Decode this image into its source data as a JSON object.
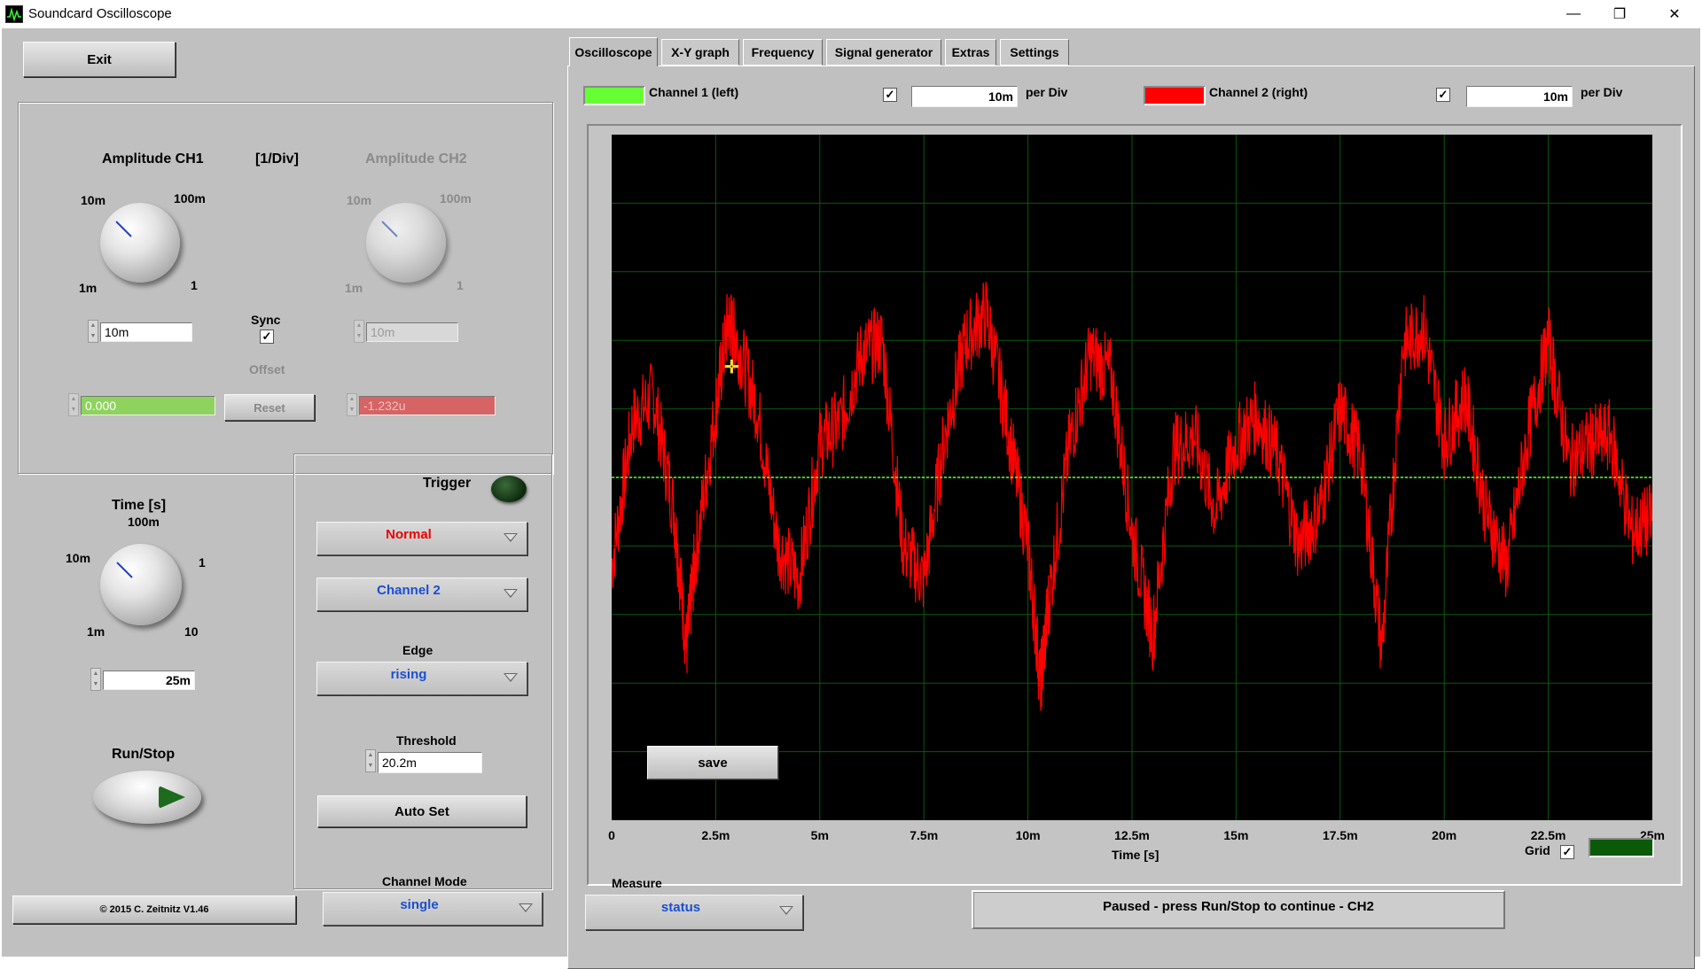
{
  "window": {
    "title": "Soundcard Oscilloscope",
    "minimize": "—",
    "restore": "❐",
    "close": "✕"
  },
  "left": {
    "exit_label": "Exit",
    "amp_ch1_title": "Amplitude CH1",
    "unit_label": "[1/Div]",
    "amp_ch2_title": "Amplitude CH2",
    "amp_ch1_scale": {
      "min": "1m",
      "a": "10m",
      "b": "100m",
      "max": "1"
    },
    "amp_ch2_scale": {
      "min": "1m",
      "a": "10m",
      "b": "100m",
      "max": "1"
    },
    "amp_ch1_value": "10m",
    "amp_ch2_value": "10m",
    "sync_label": "Sync",
    "sync_checked": "✓",
    "offset_label": "Offset",
    "offset_ch1_value": "0.000",
    "offset_ch2_value": "-1.232u",
    "reset_label": "Reset",
    "time_title": "Time [s]",
    "time_scale": {
      "min": "1m",
      "a": "10m",
      "b": "100m",
      "c": "1",
      "max": "10"
    },
    "time_value": "25m",
    "runstop_label": "Run/Stop",
    "copyright": "© 2015  C. Zeitnitz V1.46",
    "channel_mode_label": "Channel Mode",
    "channel_mode_value": "single"
  },
  "trigger": {
    "title": "Trigger",
    "mode": "Normal",
    "channel": "Channel 2",
    "edge_label": "Edge",
    "edge": "rising",
    "threshold_label": "Threshold",
    "threshold_value": "20.2m",
    "autoset_label": "Auto Set"
  },
  "tabs": [
    "Oscilloscope",
    "X-Y graph",
    "Frequency",
    "Signal generator",
    "Extras",
    "Settings"
  ],
  "scope": {
    "ch1_label": "Channel 1 (left)",
    "ch2_label": "Channel 2 (right)",
    "ch1_color": "#66ff33",
    "ch2_color": "#ff0000",
    "ch1_check": "✓",
    "ch2_check": "✓",
    "ch1_perdiv": "10m",
    "ch2_perdiv": "10m",
    "perdiv_label": "per Div",
    "save_label": "save",
    "x_ticks": [
      "0",
      "2.5m",
      "5m",
      "7.5m",
      "10m",
      "12.5m",
      "15m",
      "17.5m",
      "20m",
      "22.5m",
      "25m"
    ],
    "x_axis_label": "Time [s]",
    "grid_label": "Grid",
    "grid_check": "✓",
    "grid_color": "#0a5a0a",
    "measure_label": "Measure",
    "measure_value": "status",
    "status_text": "Paused - press Run/Stop to continue - CH2"
  },
  "chart_data": {
    "type": "line",
    "xlabel": "Time [s]",
    "xlim": [
      0,
      0.025
    ],
    "ylim_div": [
      -5,
      5
    ],
    "series": [
      {
        "name": "Channel 1 (left)",
        "color": "#66ff33",
        "x": [
          0,
          0.025
        ],
        "y_div": [
          0,
          0
        ]
      },
      {
        "name": "Channel 2 (right)",
        "color": "#ff0000",
        "x": [
          0,
          0.0005,
          0.001,
          0.0015,
          0.0018,
          0.002,
          0.0025,
          0.0028,
          0.003,
          0.0035,
          0.004,
          0.0045,
          0.005,
          0.0055,
          0.006,
          0.0065,
          0.007,
          0.0075,
          0.008,
          0.0085,
          0.009,
          0.0095,
          0.01,
          0.0103,
          0.0105,
          0.011,
          0.0115,
          0.012,
          0.0125,
          0.013,
          0.0135,
          0.014,
          0.0145,
          0.015,
          0.0155,
          0.016,
          0.0165,
          0.017,
          0.0175,
          0.018,
          0.0185,
          0.019,
          0.0195,
          0.02,
          0.0205,
          0.021,
          0.0215,
          0.022,
          0.0225,
          0.023,
          0.0235,
          0.024,
          0.0245,
          0.025
        ],
        "y_div": [
          -1.3,
          0.8,
          1.2,
          -0.5,
          -2.5,
          -1.2,
          1.0,
          2.3,
          2.0,
          1.0,
          -1.0,
          -1.5,
          0.5,
          0.8,
          1.8,
          2.0,
          -1.0,
          -1.5,
          0.6,
          2.0,
          2.4,
          0.8,
          -1.0,
          -3.0,
          -1.8,
          0.5,
          1.8,
          1.5,
          -0.8,
          -2.3,
          0.4,
          0.6,
          -0.5,
          0.5,
          0.9,
          0.3,
          -1.0,
          -0.5,
          1.0,
          0.3,
          -2.5,
          1.9,
          2.2,
          0.5,
          1.2,
          -0.5,
          -1.3,
          0.6,
          2.0,
          0.2,
          0.5,
          0.6,
          -0.8,
          -0.6
        ]
      }
    ],
    "grid": "on",
    "x_ticks": [
      "0",
      "2.5m",
      "5m",
      "7.5m",
      "10m",
      "12.5m",
      "15m",
      "17.5m",
      "20m",
      "22.5m",
      "25m"
    ]
  }
}
